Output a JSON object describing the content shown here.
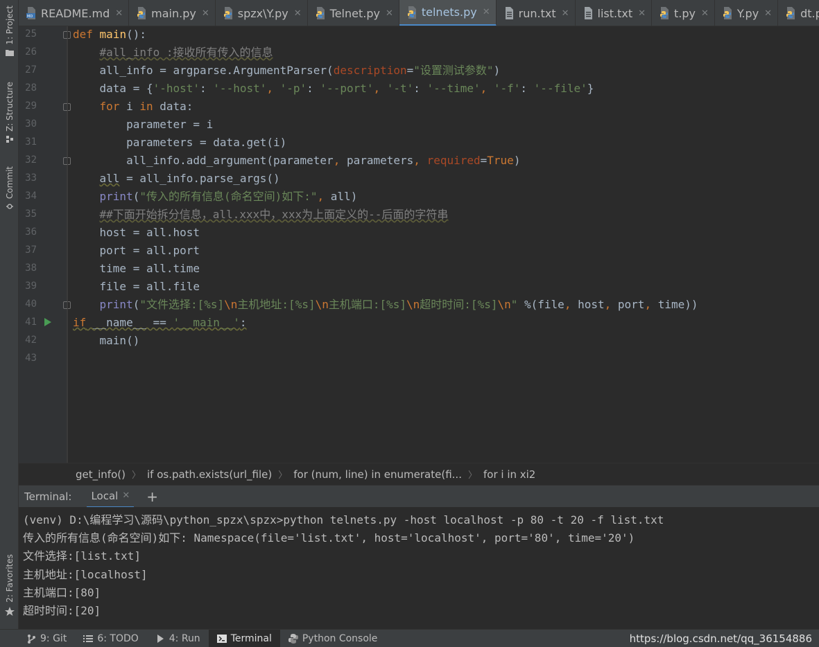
{
  "tabs": [
    {
      "label": "README.md",
      "icon": "markdown-file-icon",
      "active": false
    },
    {
      "label": "main.py",
      "icon": "python-file-icon",
      "active": false
    },
    {
      "label": "spzx\\Y.py",
      "icon": "python-file-icon",
      "active": false
    },
    {
      "label": "Telnet.py",
      "icon": "python-file-icon",
      "active": false
    },
    {
      "label": "telnets.py",
      "icon": "python-file-icon",
      "active": true
    },
    {
      "label": "run.txt",
      "icon": "text-file-icon",
      "active": false
    },
    {
      "label": "list.txt",
      "icon": "text-file-icon",
      "active": false
    },
    {
      "label": "t.py",
      "icon": "python-file-icon",
      "active": false
    },
    {
      "label": "Y.py",
      "icon": "python-file-icon",
      "active": false
    },
    {
      "label": "dt.py",
      "icon": "python-file-icon",
      "active": false
    }
  ],
  "left_tools": {
    "project": "1: Project",
    "structure": "Z: Structure",
    "commit": "Commit",
    "favorites": "2: Favorites"
  },
  "editor": {
    "line_numbers": [
      "25",
      "26",
      "27",
      "28",
      "29",
      "30",
      "31",
      "32",
      "33",
      "34",
      "35",
      "36",
      "37",
      "38",
      "39",
      "40",
      "41",
      "42",
      "43"
    ],
    "code": {
      "l25": {
        "kw": "def",
        "name": "main",
        "rest": "():"
      },
      "l26": "#all_info :接收所有传入的信息",
      "l27": {
        "a": "all_info = argparse.ArgumentParser(",
        "param": "description",
        "eq": "=",
        "str": "\"设置测试参数\"",
        "end": ")"
      },
      "l28": {
        "a": "data = {",
        "s1": "'-host'",
        "c1": ": ",
        "s2": "'--host'",
        "c2": ", ",
        "s3": "'-p'",
        "c3": ": ",
        "s4": "'--port'",
        "c4": ", ",
        "s5": "'-t'",
        "c5": ": ",
        "s6": "'--time'",
        "c6": ", ",
        "s7": "'-f'",
        "c7": ": ",
        "s8": "'--file'",
        "end": "}"
      },
      "l29": {
        "kw1": "for",
        "mid": " i ",
        "kw2": "in",
        "end": " data:"
      },
      "l30": "parameter = i",
      "l31": "parameters = data.get(i)",
      "l32": {
        "a": "all_info.add_argument(parameter",
        "comma1": ",",
        "b": " parameters",
        "comma2": ",",
        "param": " required",
        "eq": "=",
        "kw": "True",
        "end": ")"
      },
      "l33": {
        "var": "all",
        "rest": " = all_info.parse_args()"
      },
      "l34": {
        "bi": "print",
        "a": "(",
        "str": "\"传入的所有信息(命名空间)如下:\"",
        "comma": ",",
        "end": " all)"
      },
      "l35": "##下面开始拆分信息，all.xxx中，xxx为上面定义的--后面的字符串",
      "l36": "host = all.host",
      "l37": "port = all.port",
      "l38": "time = all.time",
      "l39": "file = all.file",
      "l40": {
        "bi": "print",
        "a": "(",
        "s1": "\"文件选择:[%s]",
        "e1": "\\n",
        "s2": "主机地址:[%s]",
        "e2": "\\n",
        "s3": "主机端口:[%s]",
        "e3": "\\n",
        "s4": "超时时间:[%s]",
        "e4": "\\n",
        "s5": "\"",
        "op": " %(file",
        "c1": ",",
        "b": " host",
        "c2": ",",
        "c": " port",
        "c3": ",",
        "end": " time))"
      },
      "l41": {
        "kw": "if",
        "name": " __name__ == ",
        "str": "'__main__'",
        "end": ":"
      },
      "l42": "main()",
      "l43": ""
    }
  },
  "breadcrumb": [
    "get_info()",
    "if os.path.exists(url_file)",
    "for (num, line) in enumerate(fi...",
    "for i in xi2"
  ],
  "terminal": {
    "title": "Terminal:",
    "tab": "Local",
    "lines": [
      "(venv) D:\\编程学习\\源码\\python_spzx\\spzx>python telnets.py -host localhost -p 80 -t 20 -f list.txt",
      "传入的所有信息(命名空间)如下: Namespace(file='list.txt', host='localhost', port='80', time='20')",
      "文件选择:[list.txt]",
      "主机地址:[localhost]",
      "主机端口:[80]",
      "超时时间:[20]"
    ]
  },
  "bottom_bar": {
    "git": "9: Git",
    "todo": "6: TODO",
    "run": "4: Run",
    "terminal": "Terminal",
    "python_console": "Python Console",
    "watermark": "https://blog.csdn.net/qq_36154886"
  },
  "colors": {
    "background": "#2b2b2b",
    "keyword": "#cc7832",
    "function": "#ffc66d",
    "string": "#6a8759",
    "comment": "#808080",
    "builtin": "#8888c6",
    "parameter": "#aa4926",
    "accent": "#4a88c7"
  }
}
